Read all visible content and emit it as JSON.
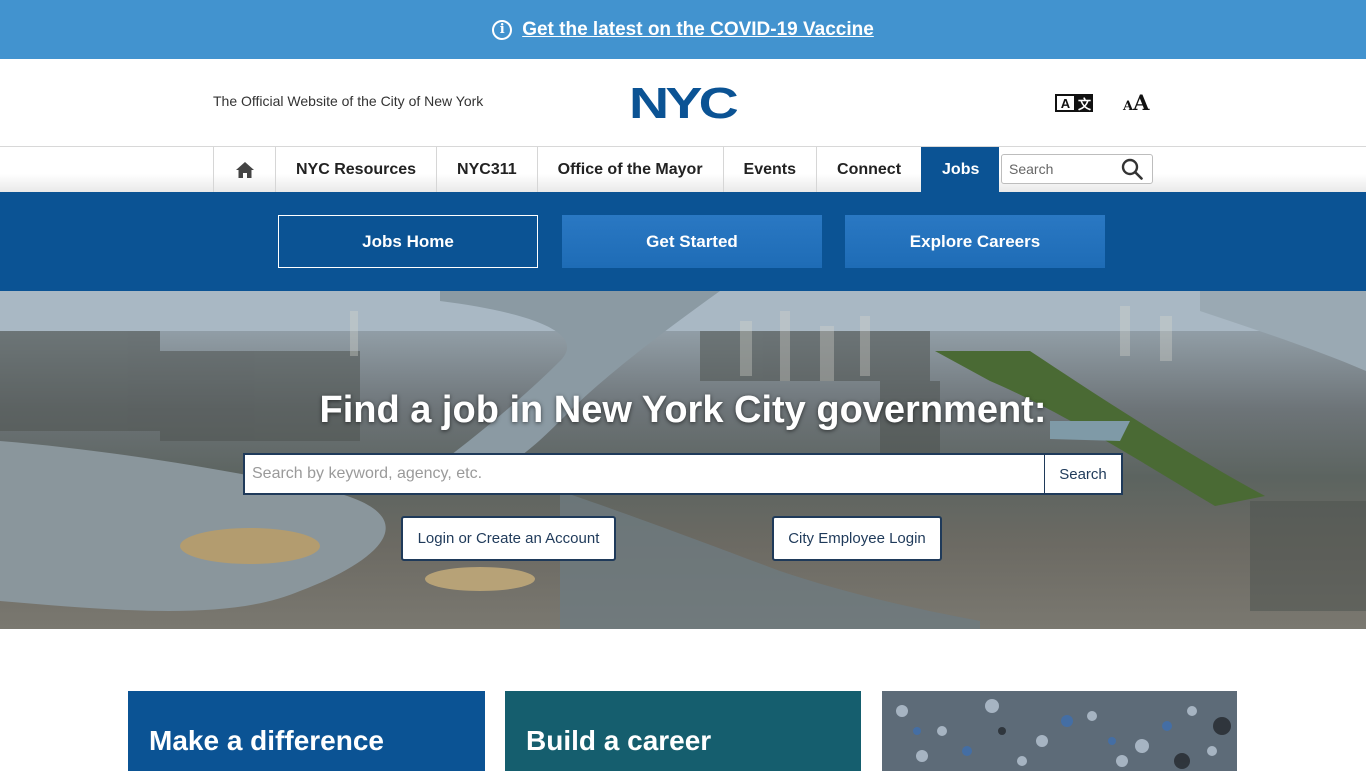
{
  "banner": {
    "icon": "info-icon",
    "link_text": "Get the latest on the COVID-19 Vaccine",
    "bg_color": "#4293cf"
  },
  "header": {
    "tagline": "The Official Website of the City of New York",
    "logo_text": "NYC",
    "logo_color": "#0b5394",
    "translate_glyph_a": "A",
    "translate_glyph_b": "文",
    "text_size_small": "A",
    "text_size_large": "A"
  },
  "nav": {
    "home_icon": "home-icon",
    "items": [
      {
        "label": "NYC Resources"
      },
      {
        "label": "NYC311"
      },
      {
        "label": "Office of the Mayor"
      },
      {
        "label": "Events"
      },
      {
        "label": "Connect"
      },
      {
        "label": "Jobs",
        "active": true
      }
    ],
    "search_placeholder": "Search"
  },
  "jobs_nav": {
    "items": [
      {
        "label": "Jobs Home"
      },
      {
        "label": "Get Started"
      },
      {
        "label": "Explore Careers"
      }
    ],
    "bg_color": "#0b5394"
  },
  "hero": {
    "title": "Find a job in New York City government:",
    "search_placeholder": "Search by keyword, agency, etc.",
    "search_button": "Search",
    "login_button": "Login or Create an Account",
    "employee_button": "City Employee Login"
  },
  "cards": [
    {
      "title": "Make a difference",
      "color": "#0b5394"
    },
    {
      "title": "Build a career",
      "color": "#155e6e"
    },
    {
      "title": "",
      "color": "#6c7a88"
    }
  ]
}
